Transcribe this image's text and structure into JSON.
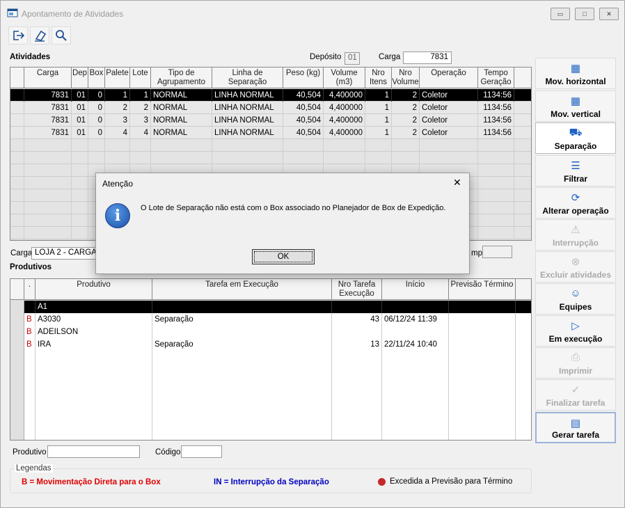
{
  "window": {
    "title": "Apontamento de Atividades",
    "minimize_icon": "▭",
    "maximize_icon": "□",
    "close_icon": "✕"
  },
  "toolbar": {
    "exit_icon": "exit-icon",
    "eraser_icon": "eraser-icon",
    "search_icon": "search-icon"
  },
  "atividades": {
    "label": "Atividades",
    "deposito_label": "Depósito",
    "deposito_value": "01",
    "carga_label": "Carga",
    "carga_value": "7831"
  },
  "activities_table": {
    "columns": [
      "Carga",
      "Dep",
      "Box",
      "Palete",
      "Lote",
      "Tipo de Agrupamento",
      "Linha de Separação",
      "Peso (kg)",
      "Volume (m3)",
      "Nro Itens",
      "Nro Volume",
      "Operação",
      "Tempo Geração"
    ],
    "rows": [
      [
        "7831",
        "01",
        "0",
        "1",
        "1",
        "NORMAL",
        "LINHA NORMAL",
        "40,504",
        "4,400000",
        "1",
        "2",
        "Coletor",
        "1134:56"
      ],
      [
        "7831",
        "01",
        "0",
        "2",
        "2",
        "NORMAL",
        "LINHA NORMAL",
        "40,504",
        "4,400000",
        "1",
        "2",
        "Coletor",
        "1134:56"
      ],
      [
        "7831",
        "01",
        "0",
        "3",
        "3",
        "NORMAL",
        "LINHA NORMAL",
        "40,504",
        "4,400000",
        "1",
        "2",
        "Coletor",
        "1134:56"
      ],
      [
        "7831",
        "01",
        "0",
        "4",
        "4",
        "NORMAL",
        "LINHA NORMAL",
        "40,504",
        "4,400000",
        "1",
        "2",
        "Coletor",
        "1134:56"
      ]
    ]
  },
  "carga_info": {
    "label": "Carga",
    "value": "LOJA 2 - CARGA F",
    "tempo_label": "mpo"
  },
  "produtivos": {
    "label": "Produtivos"
  },
  "produtivos_table": {
    "columns": [
      ".",
      "Produtivo",
      "Tarefa em Execução",
      "Nro Tarefa Execução",
      "Início",
      "Previsão Término"
    ],
    "rows": [
      [
        "",
        "A1",
        "",
        "",
        "",
        ""
      ],
      [
        "B",
        "A3030",
        "Separação",
        "43",
        "06/12/24  11:39",
        ""
      ],
      [
        "B",
        "ADEILSON",
        "",
        "",
        "",
        ""
      ],
      [
        "B",
        "IRA",
        "Separação",
        "13",
        "22/11/24  10:40",
        ""
      ]
    ]
  },
  "filters": {
    "produtivo_label": "Produtivo",
    "codigo_label": "Código"
  },
  "legend": {
    "title": "Legendas",
    "b": "B = Movimentação Direta para o Box",
    "in": "IN = Interrupção da Separação",
    "excedida": "Excedida a Previsão para Término",
    "b_color": "#e00000",
    "in_color": "#0000c0",
    "dot_color": "#c62828"
  },
  "sidebar": {
    "buttons": [
      {
        "label": "Mov. horizontal",
        "icon": "grid-icon",
        "enabled": true
      },
      {
        "label": "Mov. vertical",
        "icon": "grid-icon",
        "enabled": true
      },
      {
        "label": "Separação",
        "icon": "dolly-icon",
        "enabled": true
      },
      {
        "label": "Filtrar",
        "icon": "filter-icon",
        "enabled": true
      },
      {
        "label": "Alterar operação",
        "icon": "refresh-icon",
        "enabled": true
      },
      {
        "label": "Interrupção",
        "icon": "warning-icon",
        "enabled": false
      },
      {
        "label": "Excluir atividades",
        "icon": "delete-circle-icon",
        "enabled": false
      },
      {
        "label": "Equipes",
        "icon": "people-icon",
        "enabled": true
      },
      {
        "label": "Em execução",
        "icon": "play-icon",
        "enabled": true
      },
      {
        "label": "Imprimir",
        "icon": "printer-icon",
        "enabled": false
      },
      {
        "label": "Finalizar tarefa",
        "icon": "check-circle-icon",
        "enabled": false
      },
      {
        "label": "Gerar tarefa",
        "icon": "document-icon",
        "enabled": true
      }
    ]
  },
  "dialog": {
    "title": "Atenção",
    "message": "O Lote de Separação não está com o Box associado no Planejador de Box de Expedição.",
    "ok_label": "OK",
    "close_icon": "✕",
    "info_icon": "i"
  }
}
